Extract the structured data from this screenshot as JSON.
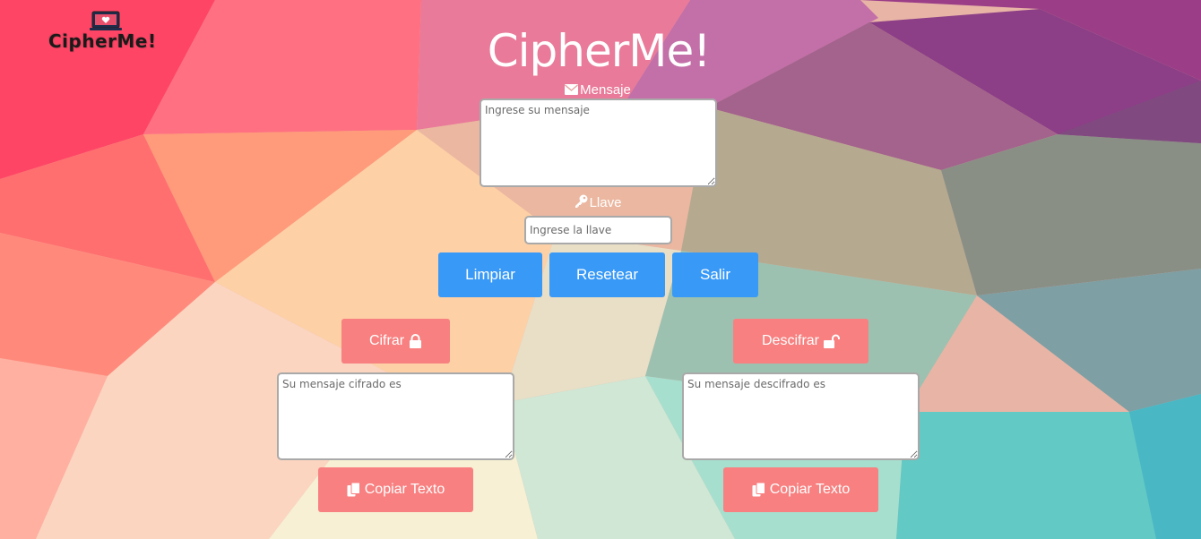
{
  "brand": {
    "logo_text": "CipherMe!",
    "title": "CipherMe!"
  },
  "message": {
    "label": "Mensaje",
    "icon": "envelope-icon",
    "placeholder": "Ingrese su mensaje",
    "value": ""
  },
  "key": {
    "label": "Llave",
    "icon": "key-icon",
    "placeholder": "Ingrese la llave",
    "value": ""
  },
  "actions": {
    "clear_label": "Limpiar",
    "reset_label": "Resetear",
    "exit_label": "Salir"
  },
  "encrypt": {
    "button_label": "Cifrar",
    "icon": "lock-icon",
    "output_placeholder": "Su mensaje cifrado es",
    "copy_label": "Copiar Texto",
    "copy_icon": "copy-icon"
  },
  "decrypt": {
    "button_label": "Descifrar",
    "icon": "unlock-icon",
    "output_placeholder": "Su mensaje descifrado es",
    "copy_label": "Copiar Texto",
    "copy_icon": "copy-icon"
  },
  "colors": {
    "primary": "#3899f7",
    "secondary": "#f88080",
    "text_light": "#ffffff"
  }
}
